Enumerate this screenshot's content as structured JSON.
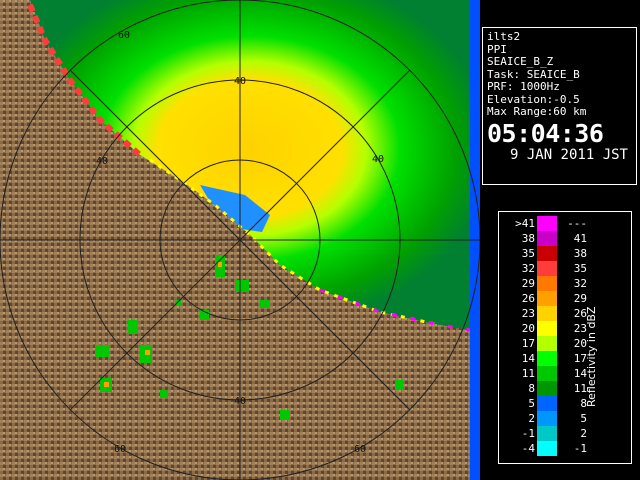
{
  "radar": {
    "range_labels": [
      "60",
      "40",
      "40",
      "40",
      "40",
      "60",
      "60"
    ]
  },
  "info": {
    "site": "ilts2",
    "product": "PPI",
    "field": "SEAICE_B_Z",
    "task": "Task: SEAICE_B",
    "prf": "PRF: 1000Hz",
    "elevation": "Elevation:-0.5",
    "max_range": "Max Range:60 km",
    "time": "05:04:36",
    "date": "9 JAN 2011 JST"
  },
  "legend": {
    "title": "Reflectivity in dBZ",
    "rows": [
      {
        "lo": ">41",
        "hi": "---",
        "color": "#ff00ff"
      },
      {
        "lo": "38",
        "hi": "41",
        "color": "#c800c8"
      },
      {
        "lo": "35",
        "hi": "38",
        "color": "#c80000"
      },
      {
        "lo": "32",
        "hi": "35",
        "color": "#ff3c3c"
      },
      {
        "lo": "29",
        "hi": "32",
        "color": "#ff7800"
      },
      {
        "lo": "26",
        "hi": "29",
        "color": "#ffa000"
      },
      {
        "lo": "23",
        "hi": "26",
        "color": "#ffd200"
      },
      {
        "lo": "20",
        "hi": "23",
        "color": "#ffff00"
      },
      {
        "lo": "17",
        "hi": "20",
        "color": "#b4ff00"
      },
      {
        "lo": "14",
        "hi": "17",
        "color": "#00ff00"
      },
      {
        "lo": "11",
        "hi": "14",
        "color": "#00c800"
      },
      {
        "lo": "8",
        "hi": "11",
        "color": "#009600"
      },
      {
        "lo": "5",
        "hi": "8",
        "color": "#0064ff"
      },
      {
        "lo": "2",
        "hi": "5",
        "color": "#0096ff"
      },
      {
        "lo": "-1",
        "hi": "2",
        "color": "#00c8c8"
      },
      {
        "lo": "-4",
        "hi": "-1",
        "color": "#00ffff"
      }
    ]
  }
}
